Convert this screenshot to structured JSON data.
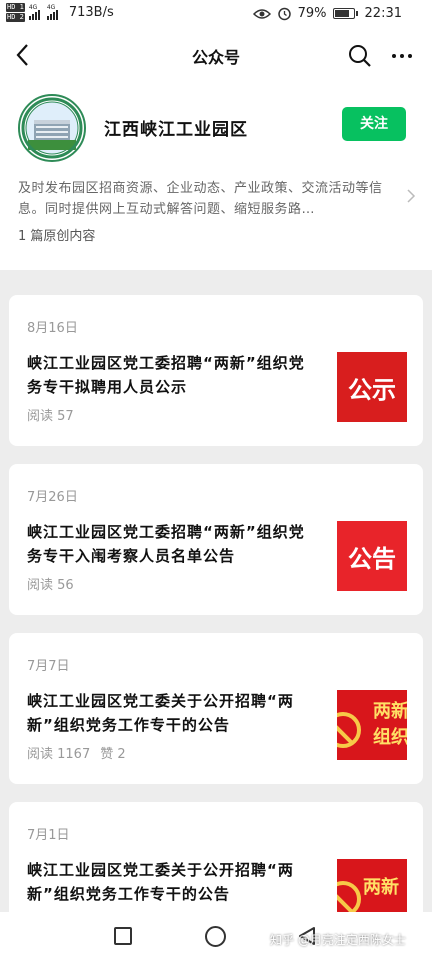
{
  "status_bar": {
    "sim1": "HD 1",
    "sim2": "HD 2",
    "net1": "4G",
    "net2": "4G",
    "speed": "713B/s",
    "battery": "79%",
    "battery_level": 0.79,
    "time": "22:31"
  },
  "nav": {
    "title": "公众号",
    "back_icon": "back-arrow-icon",
    "search_icon": "search-icon",
    "more_icon": "more-icon"
  },
  "account": {
    "name": "江西峡江工业园区",
    "follow_label": "关注",
    "description": "及时发布园区招商资源、企业动态、产业政策、交流活动等信息。同时提供网上互动式解答问题、缩短服务路…",
    "original_count": "1 篇原创内容",
    "accent_color": "#07c160"
  },
  "articles": [
    {
      "date": "8月16日",
      "title": "峡江工业园区党工委招聘“两新”组织党务专干拟聘用人员公示",
      "reads": "阅读 57",
      "likes": "",
      "thumb_text": "公示",
      "thumb_color": "#d81e1e"
    },
    {
      "date": "7月26日",
      "title": "峡江工业园区党工委招聘“两新”组织党务专干入闱考察人员名单公告",
      "reads": "阅读 56",
      "likes": "",
      "thumb_text": "公告",
      "thumb_color": "#e8242a"
    },
    {
      "date": "7月7日",
      "title": "峡江工业园区党工委关于公开招聘“两新”组织党务工作专干的公告",
      "reads": "阅读 1167",
      "likes": "赞 2",
      "thumb_text": "两新组织",
      "thumb_color": "#d8161b"
    },
    {
      "date": "7月1日",
      "title": "峡江工业园区党工委关于公开招聘“两新”组织党务工作专干的公告",
      "reads": "",
      "likes": "",
      "thumb_text": "两新",
      "thumb_color": "#d8161b"
    }
  ],
  "watermark": "知乎 @月亮注定西陈女士"
}
